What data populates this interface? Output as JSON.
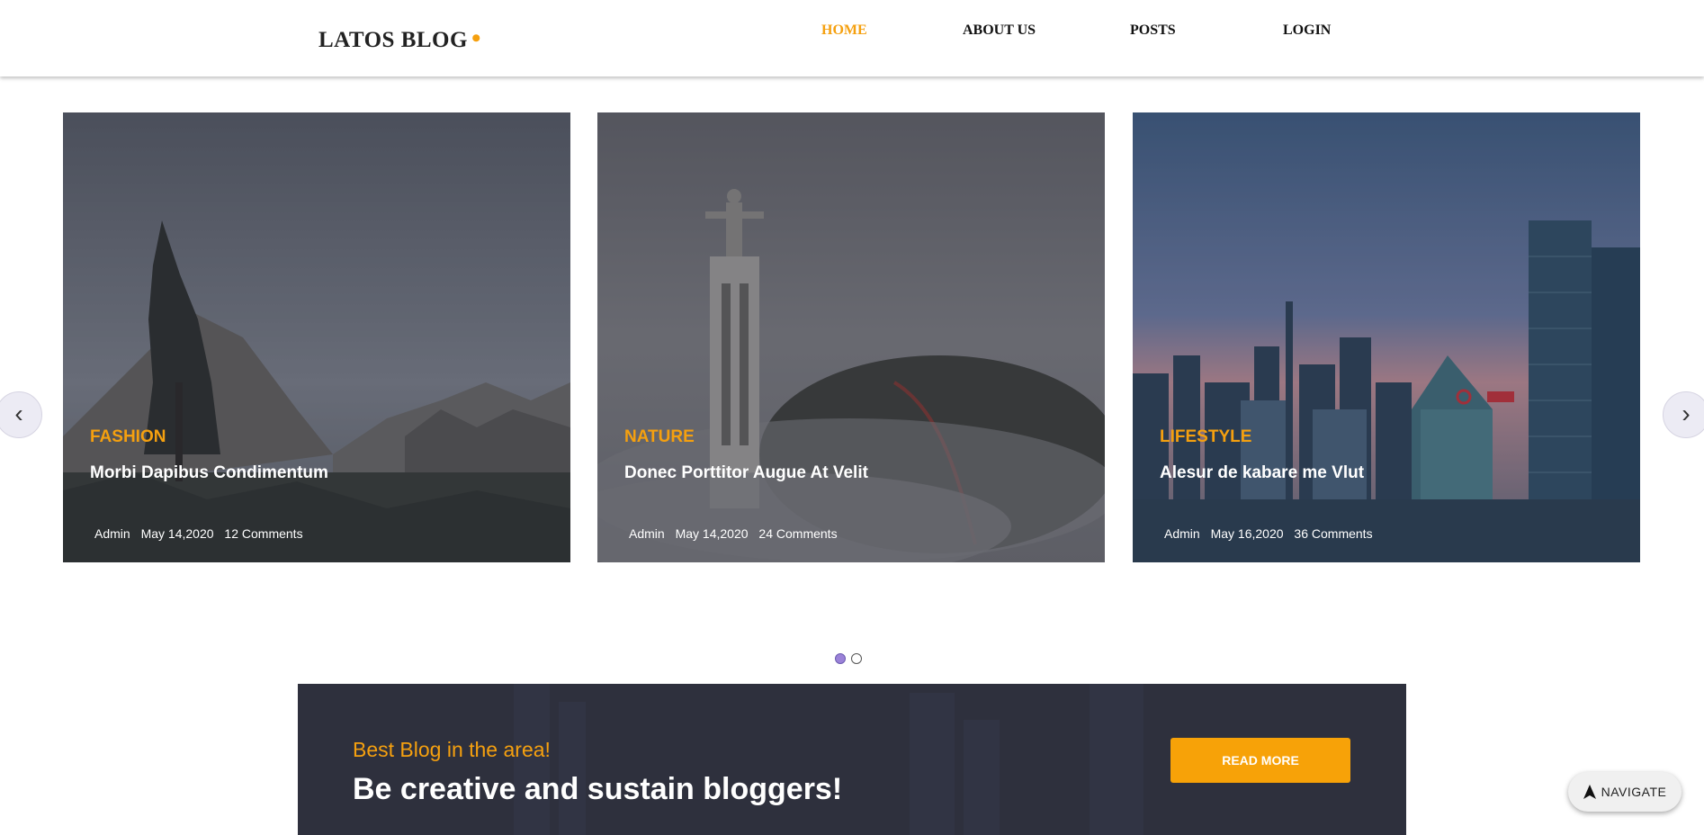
{
  "header": {
    "logo": "LATOS BLOG",
    "logo_dot": "•",
    "nav": [
      {
        "label": "HOME",
        "active": true
      },
      {
        "label": "ABOUT US",
        "active": false
      },
      {
        "label": "POSTS",
        "active": false
      },
      {
        "label": "LOGIN",
        "active": false
      }
    ]
  },
  "slider": {
    "prev_icon": "‹",
    "next_icon": "›",
    "cards": [
      {
        "category": "FASHION",
        "title": "Morbi Dapibus Condimentum",
        "author": "Admin",
        "date": "May 14,2020",
        "comments": "12 Comments"
      },
      {
        "category": "NATURE",
        "title": "Donec Porttitor Augue At Velit",
        "author": "Admin",
        "date": "May 14,2020",
        "comments": "24 Comments"
      },
      {
        "category": "LIFESTYLE",
        "title": "Alesur de kabare me Vlut",
        "author": "Admin",
        "date": "May 16,2020",
        "comments": "36 Comments"
      }
    ],
    "dots": 2,
    "active_dot": 0
  },
  "banner": {
    "tagline": "Best Blog in the area!",
    "headline": "Be creative and sustain bloggers!",
    "button": "READ MORE"
  },
  "navigate": {
    "label": "NAVIGATE",
    "icon": "navigation-arrow-icon"
  },
  "colors": {
    "accent": "#f5a00f",
    "banner_bg": "#2e303d"
  }
}
